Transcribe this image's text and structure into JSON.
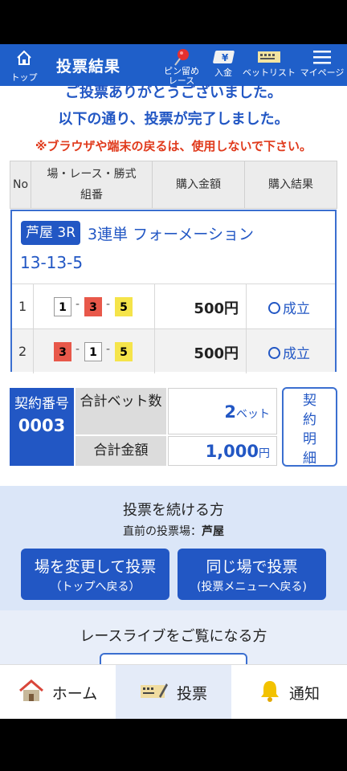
{
  "header": {
    "top_label": "トップ",
    "title": "投票結果",
    "buttons": [
      {
        "label": "ピン留め\nレース"
      },
      {
        "label": "入金"
      },
      {
        "label": "ベットリスト"
      },
      {
        "label": "マイページ"
      }
    ],
    "color": "#1f5fc9"
  },
  "messages": {
    "thanks": "ご投票ありがとうございました。",
    "complete": "以下の通り、投票が完了しました。",
    "warning": "※ブラウザや端末の戻るは、使用しないで下さい。"
  },
  "table": {
    "headers": {
      "no": "No",
      "race_line1": "場・レース・勝式",
      "race_line2": "組番",
      "amount": "購入金額",
      "result": "購入結果"
    },
    "race": {
      "badge": "芦屋 3R",
      "type": "3連単 フォーメーション",
      "combination": "13-13-5"
    },
    "rows": [
      {
        "no": "1",
        "nums": [
          "1",
          "3",
          "5"
        ],
        "amount": "500円",
        "result": "成立"
      },
      {
        "no": "2",
        "nums": [
          "3",
          "1",
          "5"
        ],
        "amount": "500円",
        "result": "成立"
      }
    ]
  },
  "summary": {
    "contract_label": "契約番号",
    "contract_no": "0003",
    "total_bets_label": "合計ベット数",
    "total_bets": "2",
    "total_bets_unit": "ベット",
    "total_amount_label": "合計金額",
    "total_amount": "1,000",
    "total_amount_unit": "円",
    "detail_button": "契約明細"
  },
  "continue": {
    "title": "投票を続ける方",
    "prev_label": "直前の投票場：",
    "prev_venue": "芦屋",
    "change_title": "場を変更して投票",
    "change_sub": "（トップへ戻る）",
    "same_title": "同じ場で投票",
    "same_sub": "(投票メニューへ戻る)"
  },
  "live": {
    "title": "レースライブをご覧になる方"
  },
  "bottom_nav": [
    {
      "label": "ホーム",
      "icon": "home-icon"
    },
    {
      "label": "投票",
      "icon": "ticket-icon"
    },
    {
      "label": "通知",
      "icon": "bell-icon"
    }
  ],
  "colors": {
    "primary": "#2257c4",
    "warning": "#e03a1c",
    "num_1": "#ffffff",
    "num_3": "#e8584a",
    "num_5": "#f5e44a"
  }
}
